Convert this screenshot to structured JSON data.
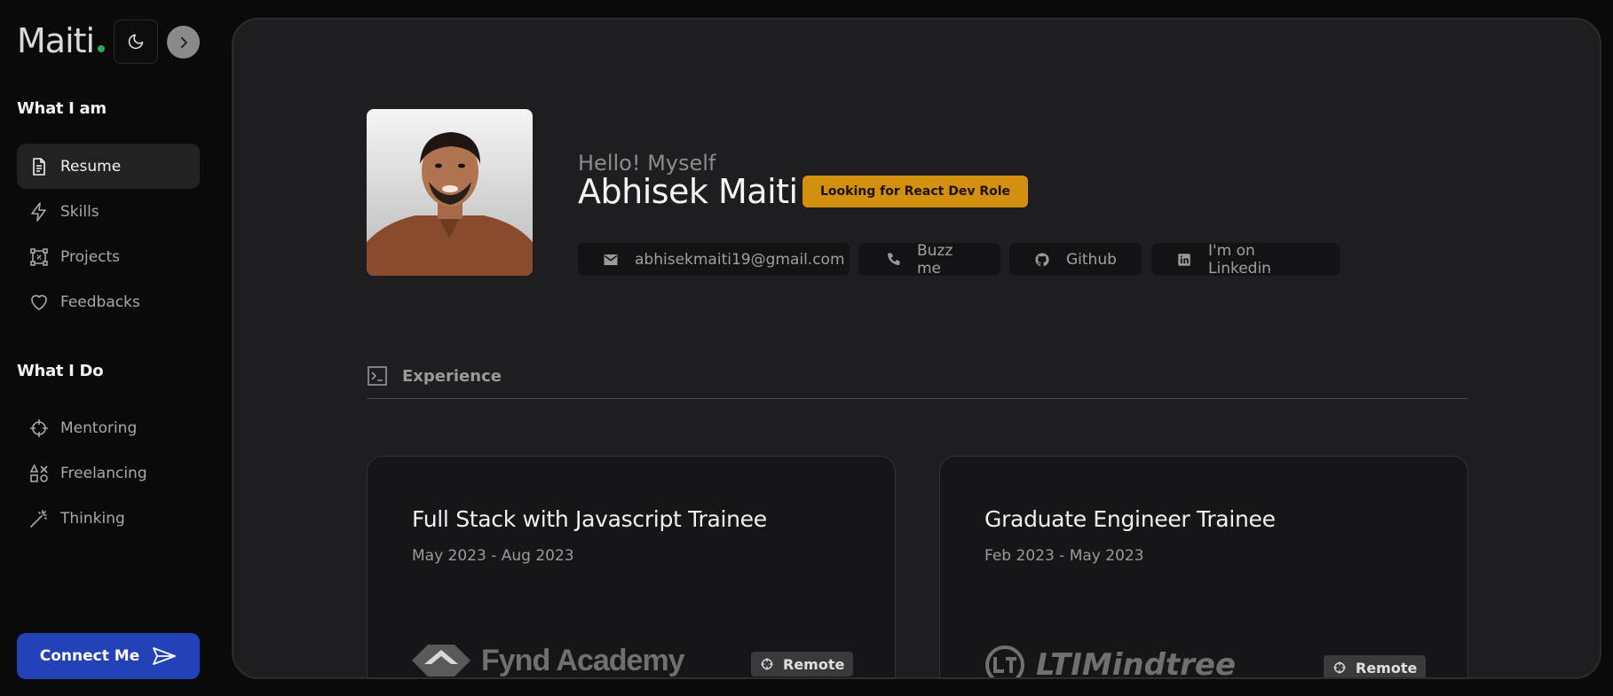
{
  "sidebar": {
    "brand": "Maiti",
    "section_1_title": "What I am",
    "section_1_items": [
      {
        "label": "Resume",
        "icon": "document-icon"
      },
      {
        "label": "Skills",
        "icon": "lightning-icon"
      },
      {
        "label": "Projects",
        "icon": "projects-icon"
      },
      {
        "label": "Feedbacks",
        "icon": "heart-icon"
      }
    ],
    "section_2_title": "What I Do",
    "section_2_items": [
      {
        "label": "Mentoring",
        "icon": "crosshair-icon"
      },
      {
        "label": "Freelancing",
        "icon": "shapes-icon"
      },
      {
        "label": "Thinking",
        "icon": "magic-wand-icon"
      }
    ],
    "connect_label": "Connect Me"
  },
  "profile": {
    "greeting": "Hello! Myself",
    "name": "Abhisek Maiti",
    "badge": "Looking for React Dev Role",
    "contacts": [
      {
        "label": "abhisekmaiti19@gmail.com",
        "icon": "mail-icon"
      },
      {
        "label": "Buzz me",
        "icon": "phone-icon"
      },
      {
        "label": "Github",
        "icon": "github-icon"
      },
      {
        "label": "I'm on Linkedin",
        "icon": "linkedin-icon"
      }
    ]
  },
  "experience": {
    "title": "Experience",
    "cards": [
      {
        "title": "Full Stack with Javascript Trainee",
        "dates": "May 2023 - Aug 2023",
        "company": "Fynd Academy",
        "location": "Remote"
      },
      {
        "title": "Graduate Engineer Trainee",
        "dates": "Feb 2023 - May 2023",
        "company": "LTIMindtree",
        "location": "Remote"
      }
    ]
  },
  "colors": {
    "accent": "#2342b8",
    "badge": "#d3900e",
    "brand_dot": "#2fa85a"
  }
}
